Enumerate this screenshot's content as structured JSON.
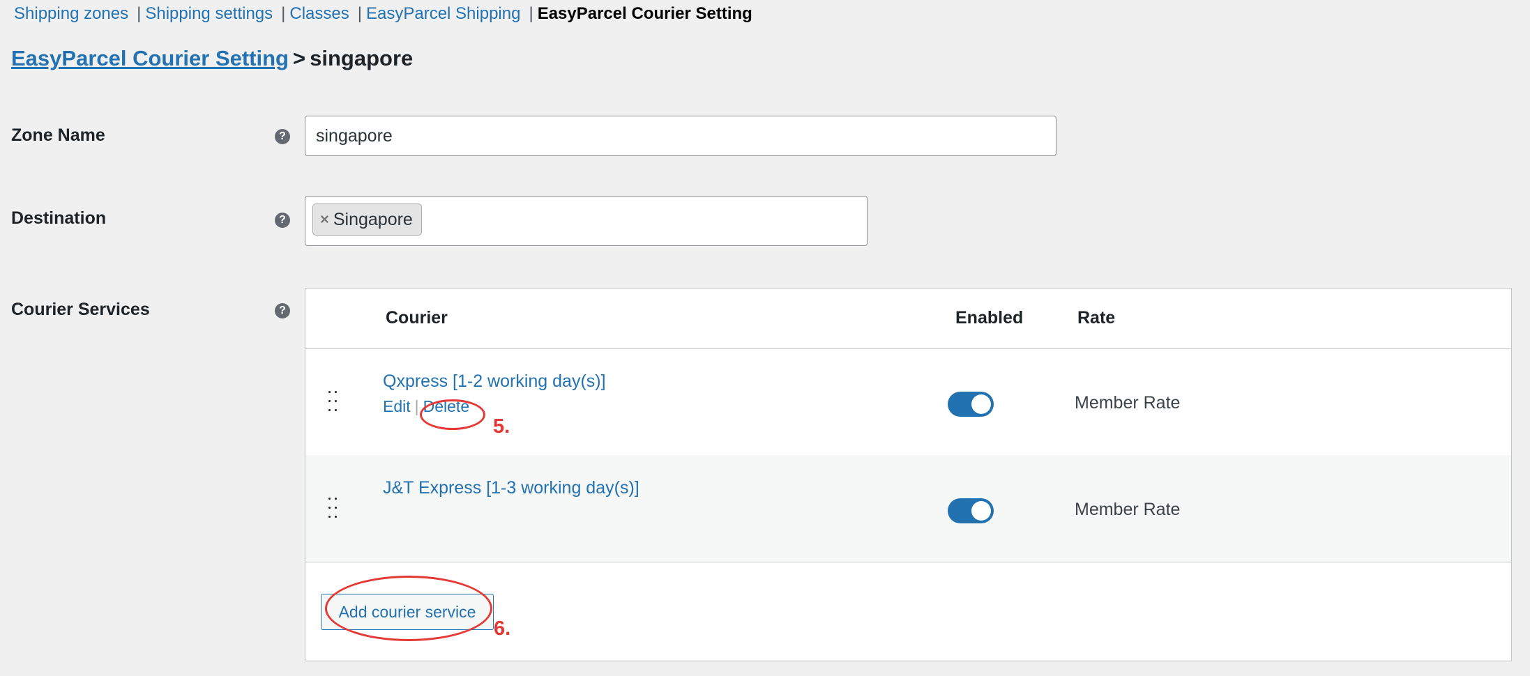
{
  "nav": {
    "items": [
      {
        "label": "Shipping zones",
        "current": false
      },
      {
        "label": "Shipping settings",
        "current": false
      },
      {
        "label": "Classes",
        "current": false
      },
      {
        "label": "EasyParcel Shipping",
        "current": false
      },
      {
        "label": "EasyParcel Courier Setting",
        "current": true
      }
    ],
    "separator": "|"
  },
  "heading": {
    "link": "EasyParcel Courier Setting",
    "separator": ">",
    "zone": "singapore"
  },
  "form": {
    "zone_name": {
      "label": "Zone Name",
      "value": "singapore",
      "help": "?"
    },
    "destination": {
      "label": "Destination",
      "chips": [
        "Singapore"
      ],
      "chip_remove": "×",
      "help": "?"
    },
    "courier_services": {
      "label": "Courier Services",
      "help": "?"
    }
  },
  "table": {
    "headers": {
      "courier": "Courier",
      "enabled": "Enabled",
      "rate": "Rate"
    },
    "rows": [
      {
        "name": "Qxpress [1-2 working day(s)]",
        "enabled": true,
        "rate": "Member Rate",
        "actions": {
          "edit": "Edit",
          "separator": "|",
          "delete": "Delete"
        }
      },
      {
        "name": "J&T Express [1-3 working day(s)]",
        "enabled": true,
        "rate": "Member Rate"
      }
    ],
    "add_button": "Add courier service"
  },
  "annotations": {
    "step5": "5.",
    "step6": "6.",
    "color": "#e53935"
  },
  "colors": {
    "link": "#2271b1",
    "background": "#f0f0f1",
    "toggle_on": "#2271b1"
  }
}
